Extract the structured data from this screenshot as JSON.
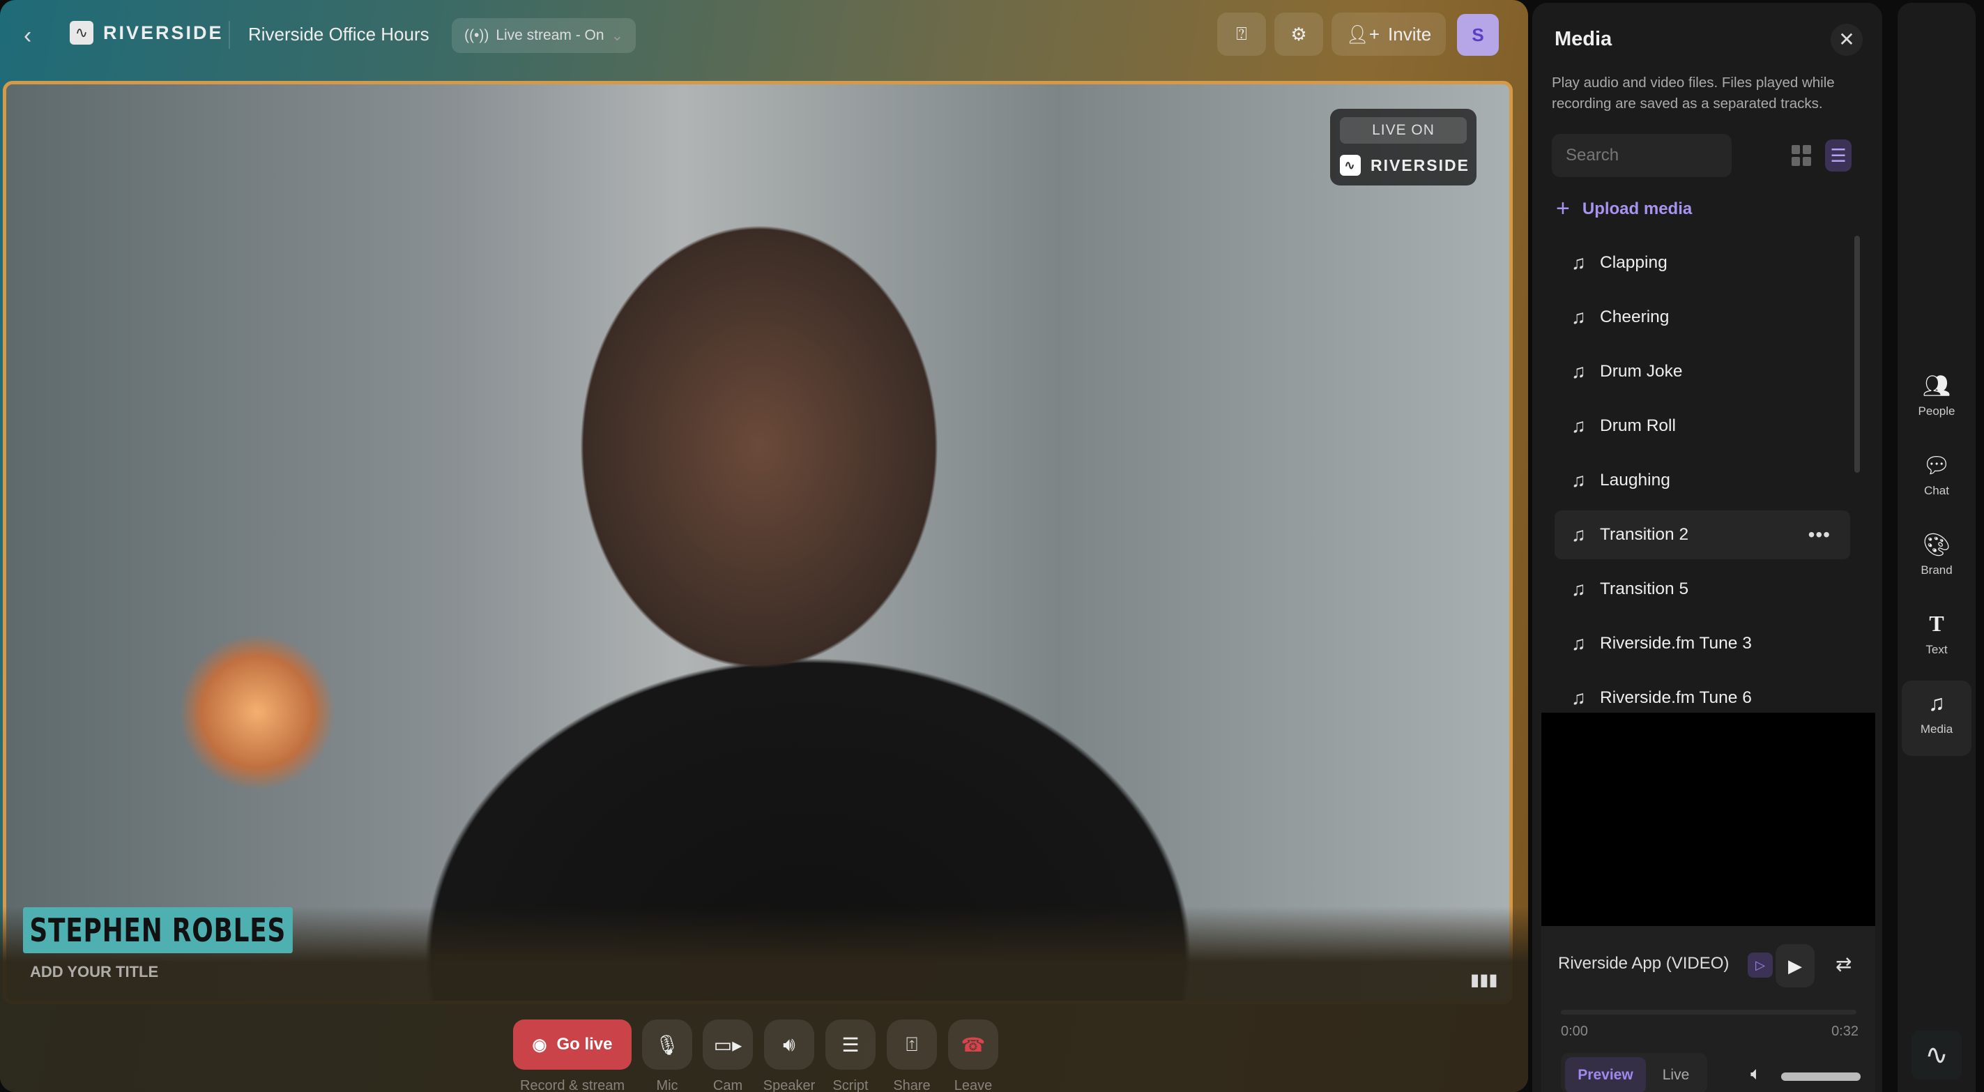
{
  "topbar": {
    "brand": "RIVERSIDE",
    "session_title": "Riverside Office Hours",
    "stream_status": "Live stream - On",
    "invite_label": "Invite",
    "avatar_initial": "S"
  },
  "video": {
    "live_on": "LIVE ON",
    "live_brand": "RIVERSIDE",
    "speaker_name": "STEPHEN ROBLES",
    "speaker_title": "ADD YOUR TITLE"
  },
  "controls": [
    {
      "label": "Record & stream",
      "button": "Go live"
    },
    {
      "label": "Mic"
    },
    {
      "label": "Cam"
    },
    {
      "label": "Speaker"
    },
    {
      "label": "Script"
    },
    {
      "label": "Share"
    },
    {
      "label": "Leave"
    }
  ],
  "media_panel": {
    "title": "Media",
    "description": "Play audio and video files. Files played while recording are saved as a separated tracks.",
    "search_placeholder": "Search",
    "upload_label": "Upload media",
    "items": [
      "Clapping",
      "Cheering",
      "Drum Joke",
      "Drum Roll",
      "Laughing",
      "Transition 2",
      "Transition 5",
      "Riverside.fm Tune 3",
      "Riverside.fm Tune 6"
    ],
    "hovered_item": "Transition 2",
    "player": {
      "track": "Riverside App (VIDEO)",
      "current_time": "0:00",
      "duration": "0:32",
      "progress": 0,
      "modes": [
        "Preview",
        "Live"
      ],
      "active_mode": "Preview",
      "volume": 1.0
    }
  },
  "right_nav": [
    {
      "label": "People",
      "icon": "people-icon"
    },
    {
      "label": "Chat",
      "icon": "chat-icon"
    },
    {
      "label": "Brand",
      "icon": "palette-icon"
    },
    {
      "label": "Text",
      "icon": "text-icon"
    },
    {
      "label": "Media",
      "icon": "music-note-icon",
      "active": true
    }
  ],
  "colors": {
    "accent": "#a993f0",
    "go_live": "#c94349",
    "lower_third": "#4fb0b2",
    "video_border": "#d49a4a"
  }
}
